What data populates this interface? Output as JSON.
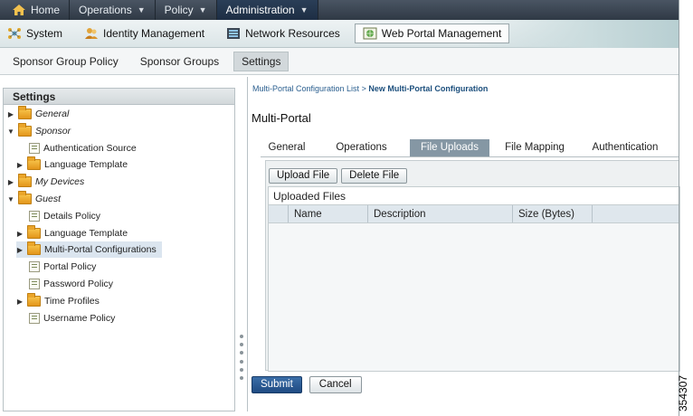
{
  "topnav": {
    "home": "Home",
    "operations": "Operations",
    "policy": "Policy",
    "administration": "Administration",
    "caret": "▼"
  },
  "subnav": {
    "system": "System",
    "identity": "Identity Management",
    "network": "Network Resources",
    "web_portal": "Web Portal Management"
  },
  "thirdnav": {
    "sponsor_group_policy": "Sponsor Group Policy",
    "sponsor_groups": "Sponsor Groups",
    "settings": "Settings"
  },
  "left": {
    "title": "Settings",
    "tree": [
      {
        "label": "General",
        "type": "folder",
        "italic": true,
        "arrow": "▶"
      },
      {
        "label": "Sponsor",
        "type": "folder",
        "italic": true,
        "arrow": "▼"
      },
      {
        "label": "Authentication Source",
        "type": "doc",
        "italic": false,
        "arrow": ""
      },
      {
        "label": "Language Template",
        "type": "folder",
        "italic": false,
        "arrow": "▶"
      },
      {
        "label": "My Devices",
        "type": "folder",
        "italic": true,
        "arrow": "▶"
      },
      {
        "label": "Guest",
        "type": "folder",
        "italic": true,
        "arrow": "▼"
      },
      {
        "label": "Details Policy",
        "type": "doc",
        "italic": false,
        "arrow": ""
      },
      {
        "label": "Language Template",
        "type": "folder",
        "italic": false,
        "arrow": "▶"
      },
      {
        "label": "Multi-Portal Configurations",
        "type": "folder",
        "italic": false,
        "arrow": "▶",
        "selected": true
      },
      {
        "label": "Portal Policy",
        "type": "doc",
        "italic": false,
        "arrow": ""
      },
      {
        "label": "Password Policy",
        "type": "doc",
        "italic": false,
        "arrow": ""
      },
      {
        "label": "Time Profiles",
        "type": "folder",
        "italic": false,
        "arrow": "▶"
      },
      {
        "label": "Username Policy",
        "type": "doc",
        "italic": false,
        "arrow": ""
      }
    ]
  },
  "main": {
    "breadcrumb_link": "Multi-Portal Configuration List",
    "breadcrumb_sep": ">",
    "breadcrumb_current": "New Multi-Portal Configuration",
    "title": "Multi-Portal",
    "tabs": [
      "General",
      "Operations",
      "File Uploads",
      "File Mapping",
      "Authentication"
    ],
    "active_tab": "File Uploads",
    "upload_button": "Upload File",
    "delete_button": "Delete File",
    "files_title": "Uploaded Files",
    "columns": [
      "Name",
      "Description",
      "Size (Bytes)"
    ],
    "submit": "Submit",
    "cancel": "Cancel"
  },
  "figure_id": "354307",
  "colors": {
    "accent": "#1f4b82",
    "active_tab": "#8597a4",
    "folder": "#e3961b"
  }
}
